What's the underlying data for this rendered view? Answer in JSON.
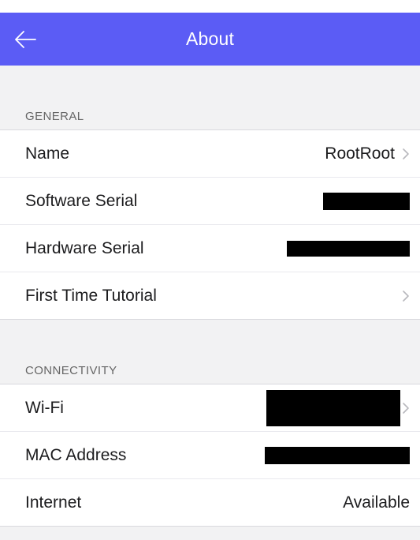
{
  "header": {
    "title": "About"
  },
  "sections": {
    "general": {
      "title": "GENERAL",
      "rows": {
        "name": {
          "label": "Name",
          "value": "RootRoot"
        },
        "software_serial": {
          "label": "Software Serial"
        },
        "hardware_serial": {
          "label": "Hardware Serial"
        },
        "tutorial": {
          "label": "First Time Tutorial"
        }
      }
    },
    "connectivity": {
      "title": "CONNECTIVITY",
      "rows": {
        "wifi": {
          "label": "Wi-Fi"
        },
        "mac": {
          "label": "MAC Address"
        },
        "internet": {
          "label": "Internet",
          "value": "Available"
        }
      }
    }
  },
  "icons": {
    "back": "arrow-left-icon",
    "disclosure": "chevron-right-icon"
  },
  "colors": {
    "accent": "#5b5cf5",
    "background": "#f2f2f3",
    "redaction": "#000000"
  }
}
